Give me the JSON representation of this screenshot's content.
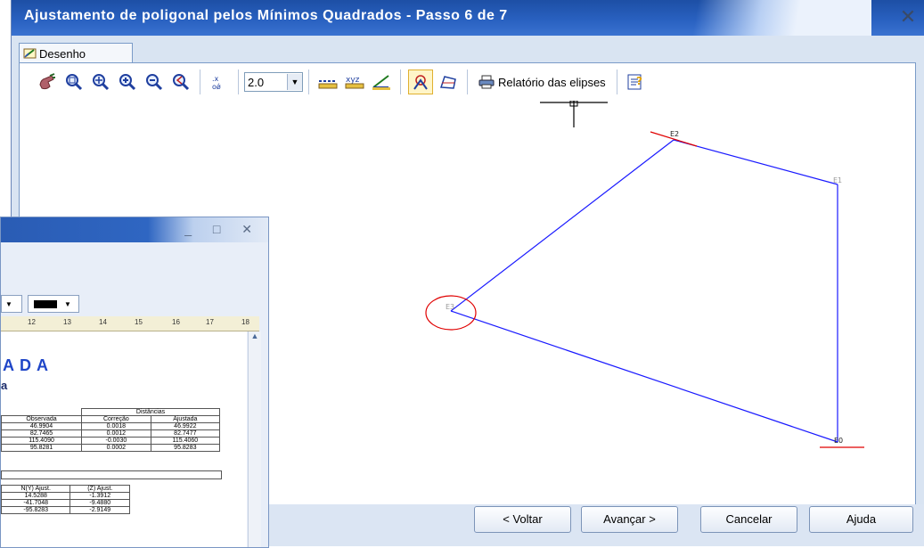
{
  "window": {
    "title": "Ajustamento de poligonal pelos Mínimos Quadrados  -  Passo 6 de 7",
    "close_glyph": "✕"
  },
  "tab": {
    "label": "Desenho",
    "icon": "drawing-tab-icon"
  },
  "toolbar": {
    "scale_value": "2.0",
    "report_label": "Relatório das elipses"
  },
  "drawing": {
    "stations": [
      "E2",
      "E1",
      "E3",
      "E0"
    ],
    "line_color": "#1a1aff",
    "ellipse_color": "#e00000"
  },
  "buttons": {
    "back": "< Voltar",
    "next": "Avançar >",
    "cancel": "Cancelar",
    "help": "Ajuda"
  },
  "report_window": {
    "controls": "_ □ ✕",
    "ruler_marks": [
      "12",
      "13",
      "14",
      "15",
      "16",
      "17",
      "18"
    ],
    "heading": "ADA",
    "subheading": "a",
    "distances_table": {
      "group_header": "Distâncias",
      "columns": [
        "Observada",
        "Correção",
        "Ajustada"
      ],
      "rows": [
        [
          "46.9904",
          "0.0018",
          "46.9922"
        ],
        [
          "82.7465",
          "0.0012",
          "82.7477"
        ],
        [
          "115.4090",
          "-0.0030",
          "115.4060"
        ],
        [
          "95.8281",
          "0.0002",
          "95.8283"
        ]
      ]
    },
    "coords_table": {
      "columns": [
        "N(Y) Ajust.",
        "(Z) Ajust."
      ],
      "rows": [
        [
          "14.5288",
          "-1.3912"
        ],
        [
          "-41.7048",
          "-9.4880"
        ],
        [
          "-95.8283",
          "-2.9149"
        ]
      ]
    }
  }
}
